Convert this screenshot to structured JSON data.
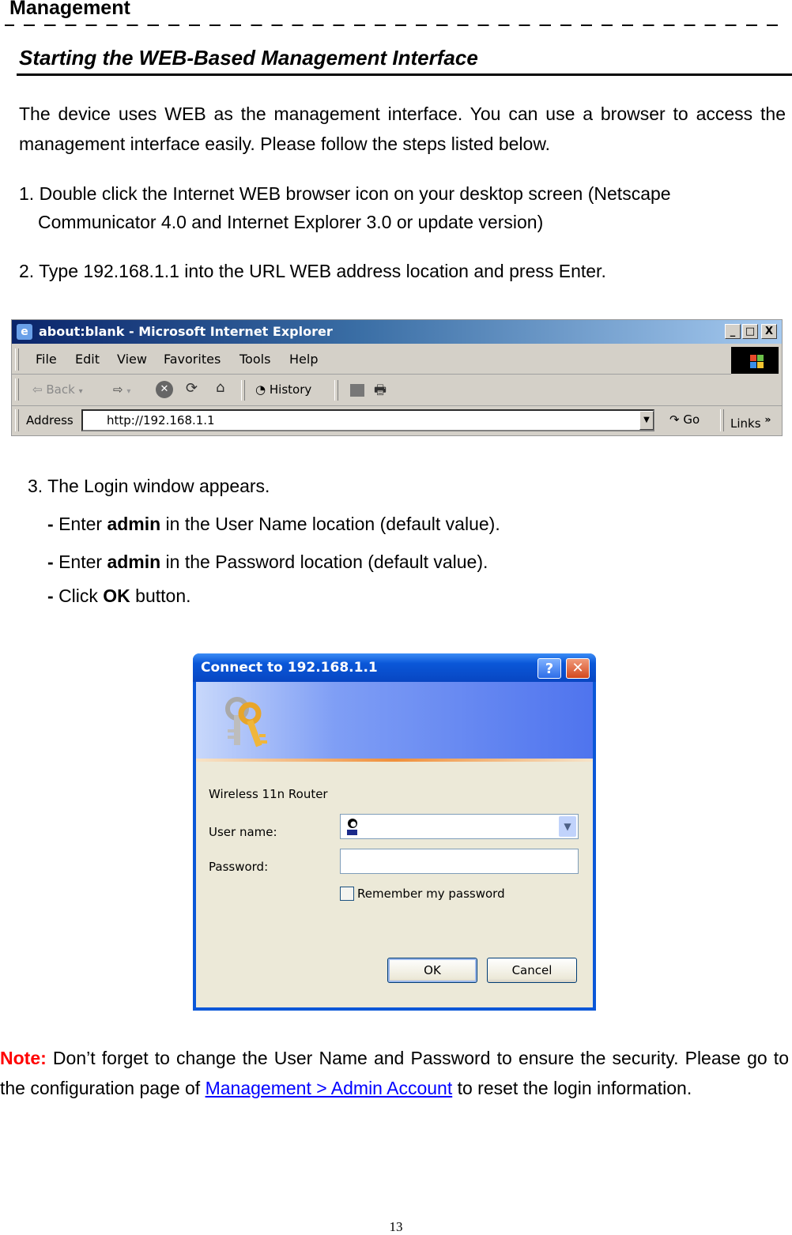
{
  "header": {
    "chapter": "Management"
  },
  "section": {
    "title": "Starting the WEB-Based Management Interface"
  },
  "intro": "The device uses WEB as the management interface. You can use a browser to access the management interface easily. Please follow the steps listed below.",
  "steps": {
    "step1_line1": "1. Double click the Internet WEB browser icon on your desktop screen (Netscape",
    "step1_line2": "Communicator 4.0 and Internet Explorer 3.0 or update version)",
    "step2": "2. Type 192.168.1.1 into the URL WEB address location and press Enter.",
    "step3": "3. The Login window appears.",
    "sub1": {
      "prefix": "- ",
      "verb": "Enter ",
      "bold": "admin",
      "rest": " in the User Name location (default value)."
    },
    "sub2": {
      "prefix": "- ",
      "verb": "Enter ",
      "bold": "admin",
      "rest": " in the Password location (default value)."
    },
    "sub3": {
      "prefix": "- ",
      "verb": "Click ",
      "bold": "OK",
      "rest": " button."
    }
  },
  "browser": {
    "title": "about:blank - Microsoft Internet Explorer",
    "window_buttons": {
      "minimize": "_",
      "maximize": "□",
      "close": "X"
    },
    "menu": [
      "File",
      "Edit",
      "View",
      "Favorites",
      "Tools",
      "Help"
    ],
    "toolbar": {
      "back": "Back",
      "history": "History"
    },
    "address_label": "Address",
    "address_value": "http://192.168.1.1",
    "go_label": "Go",
    "links_label": "Links",
    "links_chevron": "»"
  },
  "login_dialog": {
    "title": "Connect to 192.168.1.1",
    "help_glyph": "?",
    "close_glyph": "✕",
    "realm": "Wireless 11n Router",
    "username_label": "User name:",
    "username_value": "",
    "password_label": "Password:",
    "password_value": "",
    "remember_label": "Remember my password",
    "remember_checked": false,
    "ok_label": "OK",
    "cancel_label": "Cancel"
  },
  "note": {
    "label": "Note:",
    "text_before": " Don’t forget to change the User Name and Password to ensure the security. Please go to the configuration page of ",
    "link_text": "Management > Admin Account",
    "text_after": " to reset the login information."
  },
  "footer": {
    "page_number": "13"
  },
  "colors": {
    "note_label": "#ff0000",
    "link": "#0000ff",
    "xp_blue": "#0a57d8",
    "dialog_body": "#ece9d8",
    "ie_chrome": "#d4d0c8"
  }
}
